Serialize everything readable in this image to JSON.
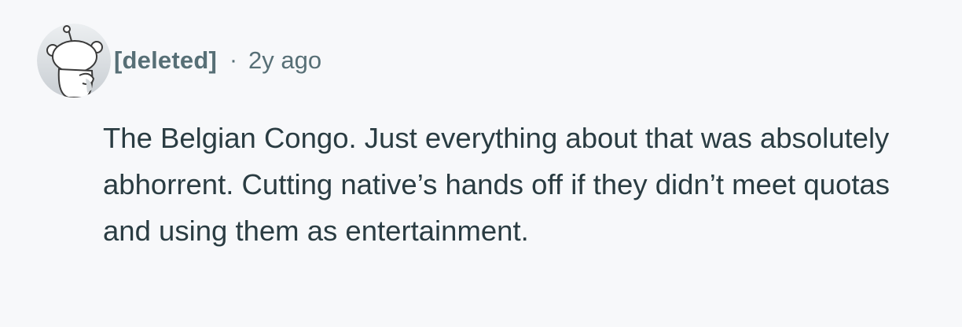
{
  "comment": {
    "author": "[deleted]",
    "separator": "·",
    "timestamp": "2y ago",
    "body": "The Belgian Congo. Just everything about that was absolutely abhorrent. Cutting native’s hands off if they didn’t meet quotas and using them as entertainment.",
    "avatar_icon": "snoo-avatar-icon"
  },
  "colors": {
    "background": "#f7f8fa",
    "meta_text": "#576f76",
    "body_text": "#2a3c42"
  }
}
